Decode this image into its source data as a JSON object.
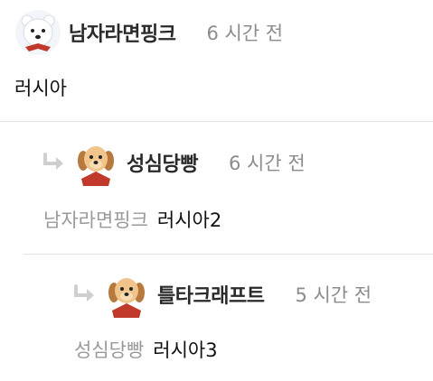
{
  "comments": [
    {
      "username": "남자라면핑크",
      "time": "6 시간 전",
      "text": "러시아",
      "avatar": "polar-bear-avatar"
    },
    {
      "username": "성심당빵",
      "time": "6 시간 전",
      "mention": "남자라면핑크",
      "text": "러시아2",
      "avatar": "puppy-avatar"
    },
    {
      "username": "틀타크래프트",
      "time": "5 시간 전",
      "mention": "성심당빵",
      "text": "러시아3",
      "avatar": "puppy-avatar"
    }
  ],
  "icons": {
    "reply": "reply-arrow-icon"
  },
  "colors": {
    "username": "#2a2a2a",
    "time": "#8c8c8c",
    "mention": "#9a9a9a",
    "divider": "#e3e3e3",
    "reply_icon": "#cfcfcf"
  }
}
